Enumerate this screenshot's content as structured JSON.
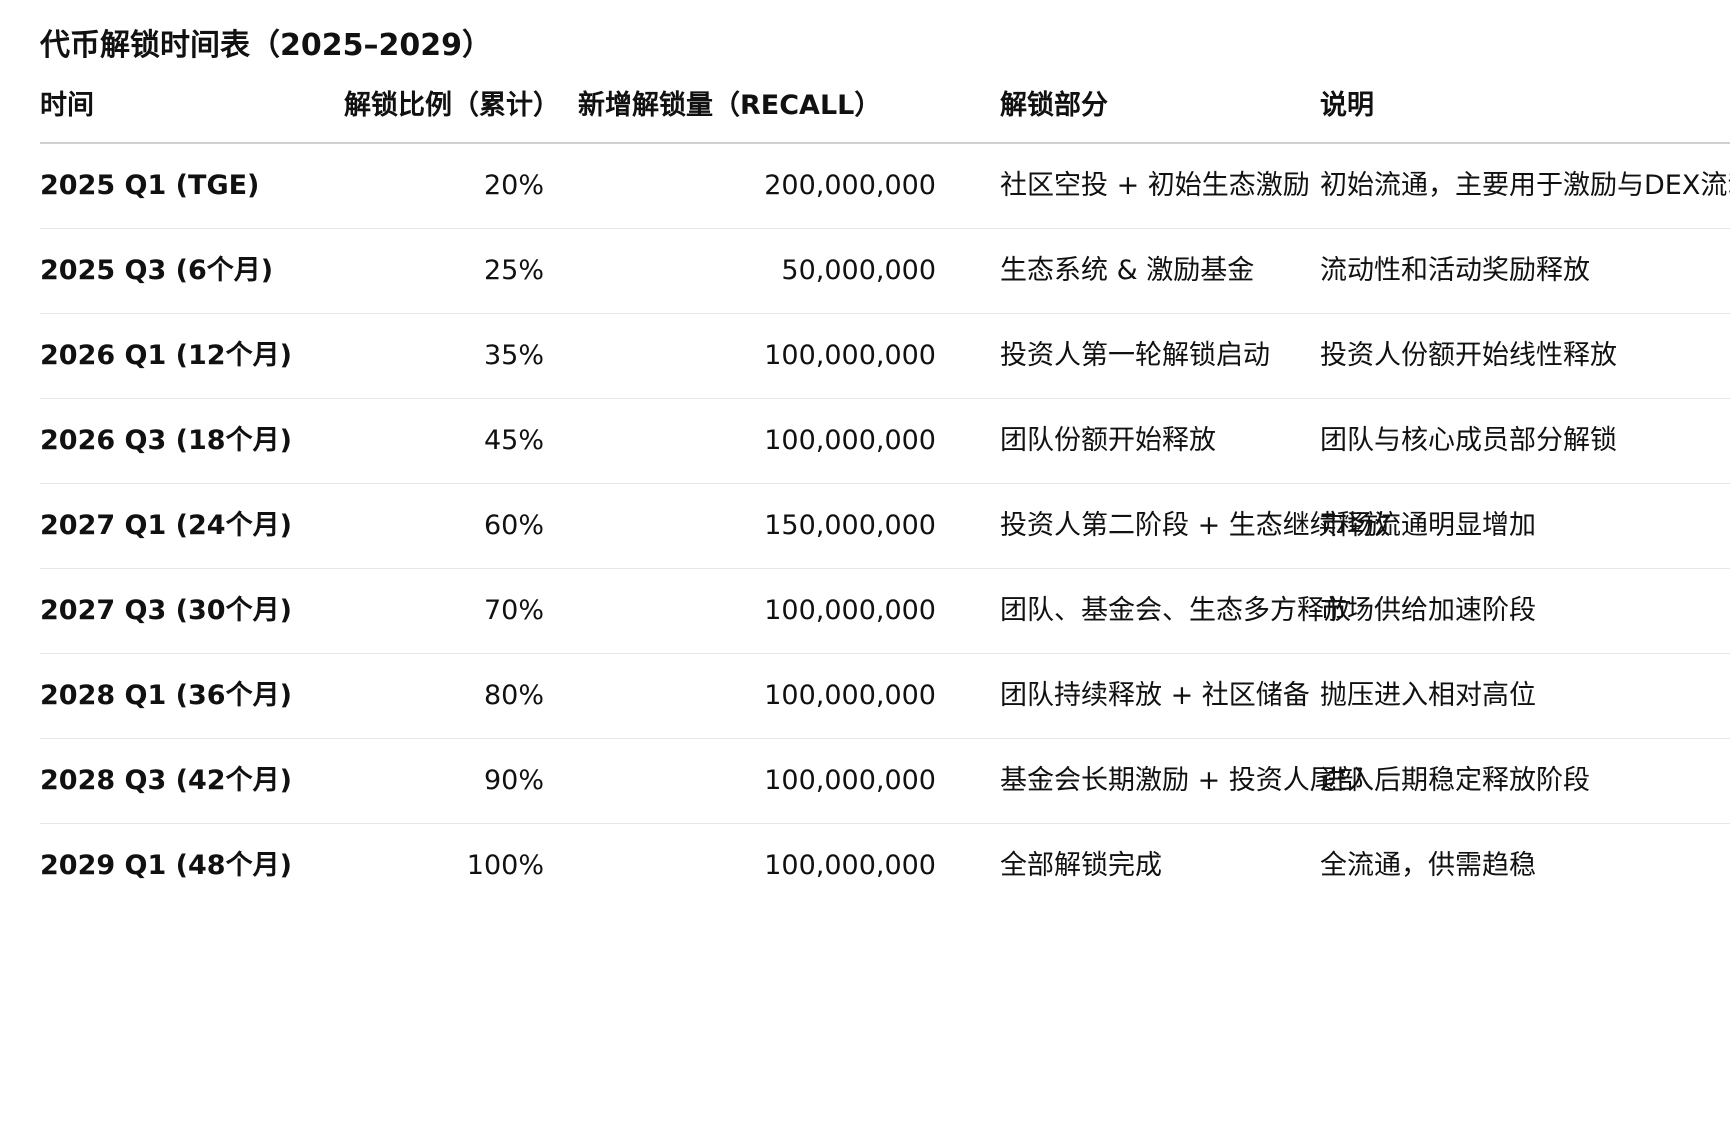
{
  "title": "代币解锁时间表（2025–2029）",
  "columns": [
    "时间",
    "解锁比例（累计）",
    "新增解锁量（RECALL）",
    "解锁部分",
    "说明"
  ],
  "rows": [
    {
      "time": "2025 Q1 (TGE)",
      "pct": "20%",
      "amount": "200,000,000",
      "part": "社区空投 + 初始生态激励",
      "note": "初始流通，主要用于激励与DEX流动性"
    },
    {
      "time": "2025 Q3 (6个月)",
      "pct": "25%",
      "amount": "50,000,000",
      "part": "生态系统 & 激励基金",
      "note": "流动性和活动奖励释放"
    },
    {
      "time": "2026 Q1 (12个月)",
      "pct": "35%",
      "amount": "100,000,000",
      "part": "投资人第一轮解锁启动",
      "note": "投资人份额开始线性释放"
    },
    {
      "time": "2026 Q3 (18个月)",
      "pct": "45%",
      "amount": "100,000,000",
      "part": "团队份额开始释放",
      "note": "团队与核心成员部分解锁"
    },
    {
      "time": "2027 Q1 (24个月)",
      "pct": "60%",
      "amount": "150,000,000",
      "part": "投资人第二阶段 + 生态继续释放",
      "note": "市场流通明显增加"
    },
    {
      "time": "2027 Q3 (30个月)",
      "pct": "70%",
      "amount": "100,000,000",
      "part": "团队、基金会、生态多方释放",
      "note": "市场供给加速阶段"
    },
    {
      "time": "2028 Q1 (36个月)",
      "pct": "80%",
      "amount": "100,000,000",
      "part": "团队持续释放 + 社区储备",
      "note": "抛压进入相对高位"
    },
    {
      "time": "2028 Q3 (42个月)",
      "pct": "90%",
      "amount": "100,000,000",
      "part": "基金会长期激励 + 投资人尾部",
      "note": "进入后期稳定释放阶段"
    },
    {
      "time": "2029 Q1 (48个月)",
      "pct": "100%",
      "amount": "100,000,000",
      "part": "全部解锁完成",
      "note": "全流通，供需趋稳"
    }
  ]
}
